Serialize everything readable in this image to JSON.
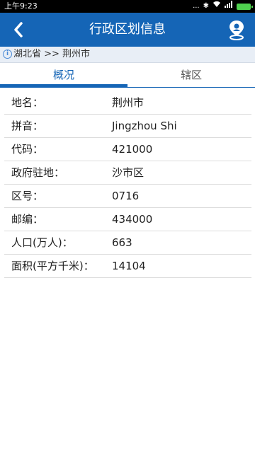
{
  "status_bar": {
    "time": "上午9:23",
    "dots": "...",
    "icons": [
      "bluetooth-icon",
      "wifi-icon",
      "signal-icon",
      "battery-icon"
    ],
    "battery_color": "#4fd14f"
  },
  "header": {
    "title": "行政区划信息",
    "back_icon": "chevron-left-icon",
    "location_icon": "location-user-icon",
    "color": "#1565b6"
  },
  "breadcrumb": {
    "text": "湖北省 >> 荆州市"
  },
  "tabs": [
    {
      "label": "概况",
      "active": true
    },
    {
      "label": "辖区",
      "active": false
    }
  ],
  "info": [
    {
      "label": "地名：",
      "value": "荆州市"
    },
    {
      "label": "拼音：",
      "value": "Jingzhou Shi"
    },
    {
      "label": "代码：",
      "value": "421000"
    },
    {
      "label": "政府驻地：",
      "value": "沙市区"
    },
    {
      "label": "区号：",
      "value": "0716"
    },
    {
      "label": "邮编：",
      "value": "434000"
    },
    {
      "label": "人口(万人)：",
      "value": "663"
    },
    {
      "label": "面积(平方千米)：",
      "value": "14104"
    }
  ]
}
